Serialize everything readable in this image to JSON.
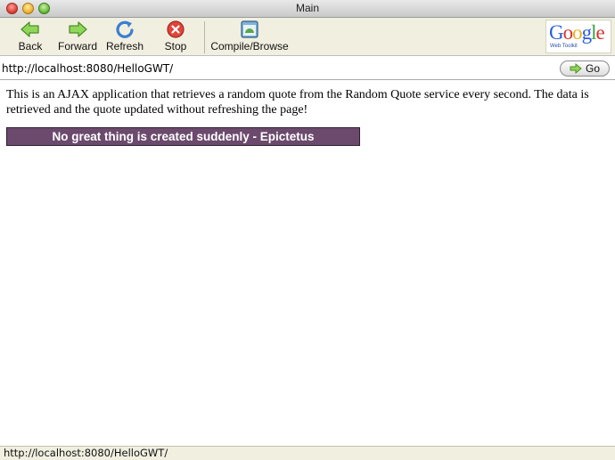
{
  "window": {
    "title": "Main"
  },
  "toolbar": {
    "back_label": "Back",
    "forward_label": "Forward",
    "refresh_label": "Refresh",
    "stop_label": "Stop",
    "compile_label": "Compile/Browse"
  },
  "logo": {
    "word": "Google",
    "sub": "Web Toolkit"
  },
  "address": {
    "url": "http://localhost:8080/HelloGWT/",
    "go_label": "Go"
  },
  "page": {
    "intro": "This is an AJAX application that retrieves a random quote from the Random Quote service every second. The data is retrieved and the quote updated without refreshing the page!",
    "quote": "No great thing is created suddenly - Epictetus"
  },
  "status": {
    "text": "http://localhost:8080/HelloGWT/"
  },
  "colors": {
    "quote_bg": "#6b4a6d",
    "toolbar_bg": "#f1efe0",
    "arrow_green": "#7ac943",
    "stop_red": "#e0443a"
  },
  "icons": [
    "back-arrow-icon",
    "forward-arrow-icon",
    "refresh-icon",
    "stop-icon",
    "compile-browse-icon",
    "go-arrow-icon"
  ]
}
